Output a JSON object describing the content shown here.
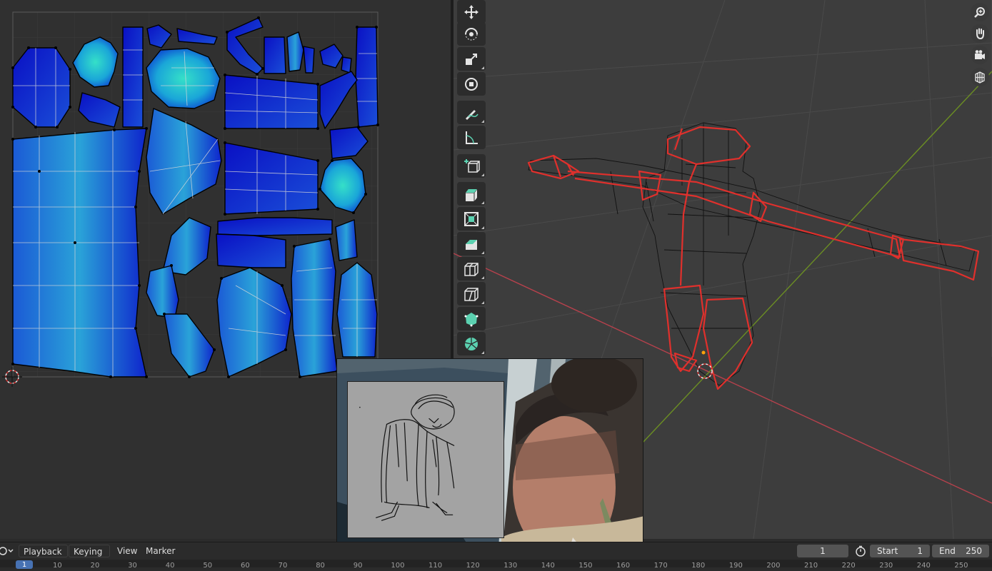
{
  "uv_editor": {
    "name": "UV Editor"
  },
  "viewport": {
    "name": "3D Viewport"
  },
  "toolbar": {
    "tools": [
      {
        "name": "move-tool-icon",
        "active": false
      },
      {
        "name": "rotate-tool-icon",
        "active": false
      },
      {
        "name": "scale-tool-icon",
        "active": false
      },
      {
        "name": "transform-tool-icon",
        "active": false
      },
      {
        "name": "annotate-tool-icon",
        "active": false
      },
      {
        "name": "measure-tool-icon",
        "active": false
      },
      {
        "name": "add-cube-tool-icon",
        "active": false
      },
      {
        "name": "extrude-tool-icon",
        "active": false
      },
      {
        "name": "inset-faces-tool-icon",
        "active": false
      },
      {
        "name": "bevel-tool-icon",
        "active": false
      },
      {
        "name": "loop-cut-tool-icon",
        "active": false
      },
      {
        "name": "knife-tool-icon",
        "active": false
      },
      {
        "name": "poly-build-tool-icon",
        "active": false
      },
      {
        "name": "spin-tool-icon",
        "active": false
      }
    ]
  },
  "navigation": {
    "icons": [
      "zoom-icon",
      "pan-hand-icon",
      "camera-view-icon",
      "ortho-grid-icon"
    ]
  },
  "colors": {
    "uv_island_fill": "#0b12c8",
    "uv_stretch_high": "#28d0c0",
    "seam_red": "#e0302c",
    "axis_x": "#b6414c",
    "axis_y": "#6b8e23",
    "accent_blue": "#4772b3"
  },
  "timeline": {
    "menus": {
      "playback": "Playback",
      "keying": "Keying",
      "view": "View",
      "marker": "Marker"
    },
    "current_frame": "1",
    "start_label": "Start",
    "start_value": "1",
    "end_label": "End",
    "end_value": "250",
    "ruler_ticks": [
      "1",
      "10",
      "20",
      "30",
      "40",
      "50",
      "60",
      "70",
      "80",
      "90",
      "100",
      "110",
      "120",
      "130",
      "140",
      "150",
      "160",
      "170",
      "180",
      "190",
      "200",
      "210",
      "220",
      "230",
      "240",
      "250"
    ]
  }
}
